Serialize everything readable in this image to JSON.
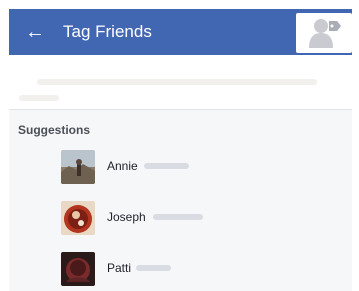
{
  "header": {
    "title": "Tag Friends",
    "back_icon": "arrow-left-icon",
    "tag_icon": "person-tag-icon",
    "background": "#4267b2"
  },
  "search": {
    "placeholder": ""
  },
  "suggestions": {
    "heading": "Suggestions",
    "items": [
      {
        "first_name": "Annie"
      },
      {
        "first_name": "Joseph"
      },
      {
        "first_name": "Patti"
      }
    ]
  }
}
